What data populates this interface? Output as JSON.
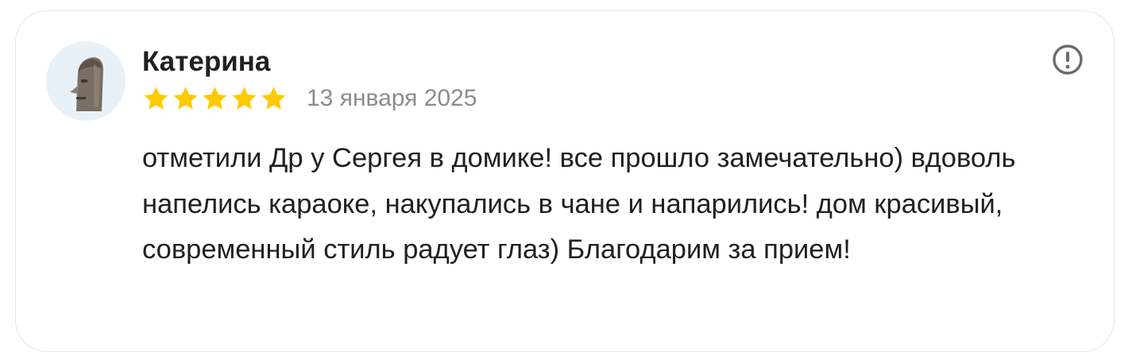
{
  "review": {
    "author": "Катерина",
    "rating": 5,
    "rating_max": 5,
    "date": "13 января 2025",
    "text": "отметили Др у Сергея в домике! все прошло замечательно) вдоволь напелись караоке, накупались в чане и напарились! дом красивый, современный стиль радует глаз) Благодарим за прием!"
  },
  "icons": {
    "avatar": "stone-head-avatar",
    "star": "star-icon",
    "report": "exclamation-circle-icon"
  },
  "colors": {
    "star": "#fcca00",
    "text": "#21201f",
    "date": "#8c8c8c",
    "avatar_bg": "#e8f1f8",
    "report_icon": "#6b6b6b"
  }
}
